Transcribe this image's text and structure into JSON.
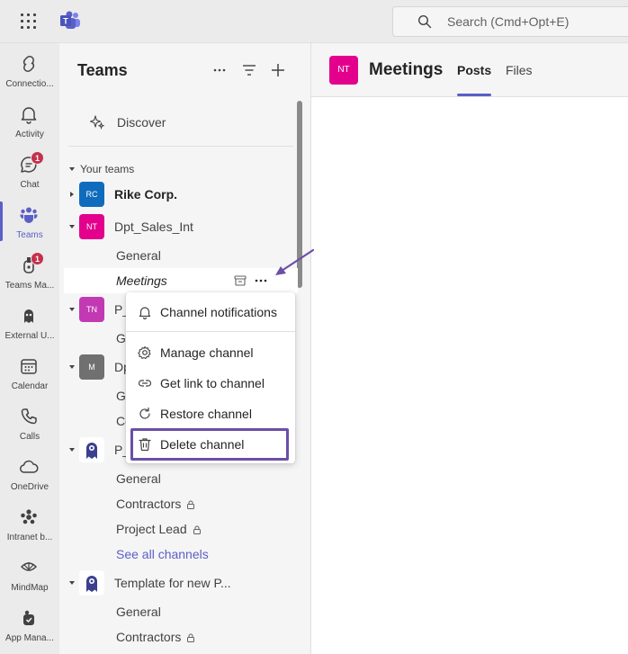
{
  "topbar": {
    "search_placeholder": "Search (Cmd+Opt+E)"
  },
  "rail": {
    "items": [
      {
        "label": "Connectio...",
        "icon": "connections-icon"
      },
      {
        "label": "Activity",
        "icon": "bell-icon"
      },
      {
        "label": "Chat",
        "icon": "chat-icon",
        "badge": "1"
      },
      {
        "label": "Teams",
        "icon": "teams-icon",
        "active": true
      },
      {
        "label": "Teams Ma...",
        "icon": "teams-manager-icon",
        "badge": "1"
      },
      {
        "label": "External U...",
        "icon": "external-users-icon"
      },
      {
        "label": "Calendar",
        "icon": "calendar-icon"
      },
      {
        "label": "Calls",
        "icon": "phone-icon"
      },
      {
        "label": "OneDrive",
        "icon": "cloud-icon"
      },
      {
        "label": "Intranet b...",
        "icon": "intranet-icon"
      },
      {
        "label": "MindMap",
        "icon": "mindmap-icon"
      },
      {
        "label": "App Mana...",
        "icon": "app-manager-icon"
      }
    ]
  },
  "panel": {
    "title": "Teams",
    "discover": "Discover",
    "your_teams": "Your teams",
    "teams": [
      {
        "initials": "RC",
        "name": "Rike Corp.",
        "color": "#0f6cbd"
      },
      {
        "initials": "NT",
        "name": "Dpt_Sales_Int",
        "color": "#e3008c",
        "channels": [
          "General",
          "Meetings"
        ]
      },
      {
        "initials": "TN",
        "name": "P_",
        "color": "#c239b3",
        "channels": [
          "Ge"
        ]
      },
      {
        "initials": "M",
        "name": "Dp",
        "color": "#707070",
        "channels": [
          "Ge",
          "Co"
        ]
      },
      {
        "name": "P_",
        "channels": [
          "General",
          "Contractors",
          "Project Lead"
        ],
        "see_all": "See all channels"
      },
      {
        "name": "Template for new P...",
        "channels": [
          "General",
          "Contractors"
        ]
      }
    ]
  },
  "main": {
    "avatar": "NT",
    "title": "Meetings",
    "tabs": [
      "Posts",
      "Files"
    ]
  },
  "menu": {
    "items": [
      "Channel notifications",
      "Manage channel",
      "Get link to channel",
      "Restore channel",
      "Delete channel"
    ]
  },
  "colors": {
    "accent": "#5b5fc7",
    "highlight": "#6b4fa6",
    "badge": "#c4314b"
  }
}
